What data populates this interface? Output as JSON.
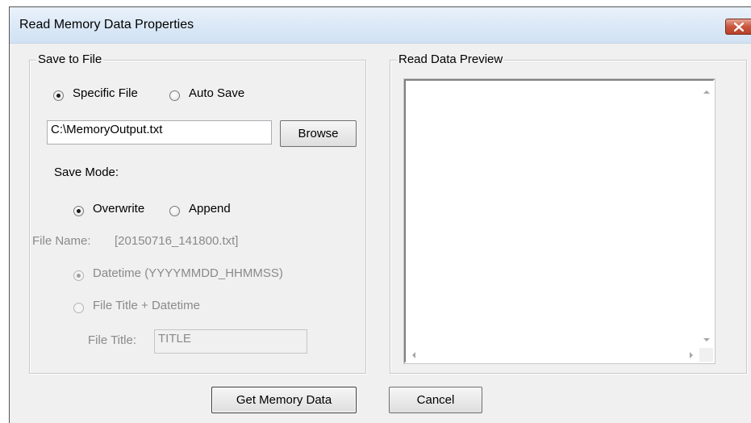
{
  "window": {
    "title": "Read Memory Data Properties"
  },
  "save_group": {
    "label": "Save to File",
    "radio_specific": "Specific File",
    "radio_auto": "Auto Save",
    "file_path": "C:\\MemoryOutput.txt",
    "browse_label": "Browse",
    "save_mode_label": "Save Mode:",
    "radio_overwrite": "Overwrite",
    "radio_append": "Append",
    "file_name_label": "File Name:",
    "file_name_value": "[20150716_141800.txt]",
    "radio_datetime": "Datetime (YYYYMMDD_HHMMSS)",
    "radio_title_datetime": "File Title + Datetime",
    "file_title_label": "File Title:",
    "file_title_value": "TITLE"
  },
  "preview_group": {
    "label": "Read Data Preview",
    "content": ""
  },
  "buttons": {
    "get_label": "Get Memory Data",
    "cancel_label": "Cancel"
  },
  "colors": {
    "close_button": "#c8553c",
    "dialog_bg": "#f0f0f0"
  },
  "icons": {
    "close": "close-icon",
    "scroll_up": "scroll-up-arrow-icon",
    "scroll_down": "scroll-down-arrow-icon",
    "scroll_left": "scroll-left-arrow-icon",
    "scroll_right": "scroll-right-arrow-icon"
  }
}
